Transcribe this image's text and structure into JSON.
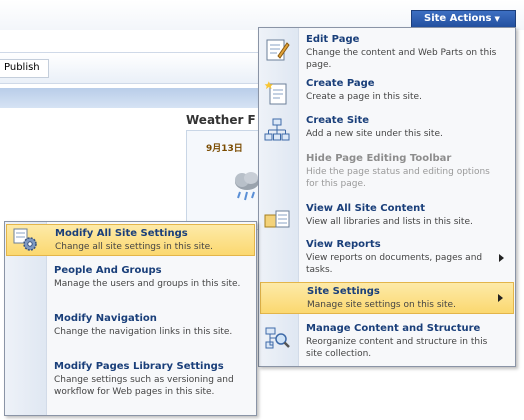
{
  "header": {
    "site_actions_label": "Site Actions"
  },
  "toolbar": {
    "publish_label": "Publish"
  },
  "weather": {
    "title": "Weather F",
    "date": "9月13日"
  },
  "site_actions_menu": {
    "items": [
      {
        "title": "Edit Page",
        "desc": "Change the content and Web Parts on this page.",
        "icon": "edit-page-icon",
        "enabled": true
      },
      {
        "title": "Create Page",
        "desc": "Create a page in this site.",
        "icon": "create-page-icon",
        "enabled": true
      },
      {
        "title": "Create Site",
        "desc": "Add a new site under this site.",
        "icon": "create-site-icon",
        "enabled": true
      },
      {
        "title": "Hide Page Editing Toolbar",
        "desc": "Hide the page status and editing options for this page.",
        "icon": "hide-toolbar-icon",
        "enabled": false
      },
      {
        "title": "View All Site Content",
        "desc": "View all libraries and lists in this site.",
        "icon": "view-content-icon",
        "enabled": true
      },
      {
        "title": "View Reports",
        "desc": "View reports on documents, pages and tasks.",
        "icon": "view-reports-icon",
        "enabled": true,
        "submenu": true
      },
      {
        "title": "Site Settings",
        "desc": "Manage site settings on this site.",
        "icon": "site-settings-icon",
        "enabled": true,
        "submenu": true,
        "highlighted": true
      },
      {
        "title": "Manage Content and Structure",
        "desc": "Reorganize content and structure in this site collection.",
        "icon": "manage-content-icon",
        "enabled": true
      }
    ]
  },
  "site_settings_submenu": {
    "items": [
      {
        "title": "Modify All Site Settings",
        "desc": "Change all site settings in this site.",
        "icon": "settings-gear-icon",
        "highlighted": true
      },
      {
        "title": "People And Groups",
        "desc": "Manage the users and groups in this site."
      },
      {
        "title": "Modify Navigation",
        "desc": "Change the navigation links in this site."
      },
      {
        "title": "Modify Pages Library Settings",
        "desc": "Change settings such as versioning and workflow for Web pages in this site."
      }
    ]
  },
  "colors": {
    "site_actions_bg": "#2a58a8",
    "menu_title": "#1a3f7a",
    "highlight": "#fbd870"
  }
}
